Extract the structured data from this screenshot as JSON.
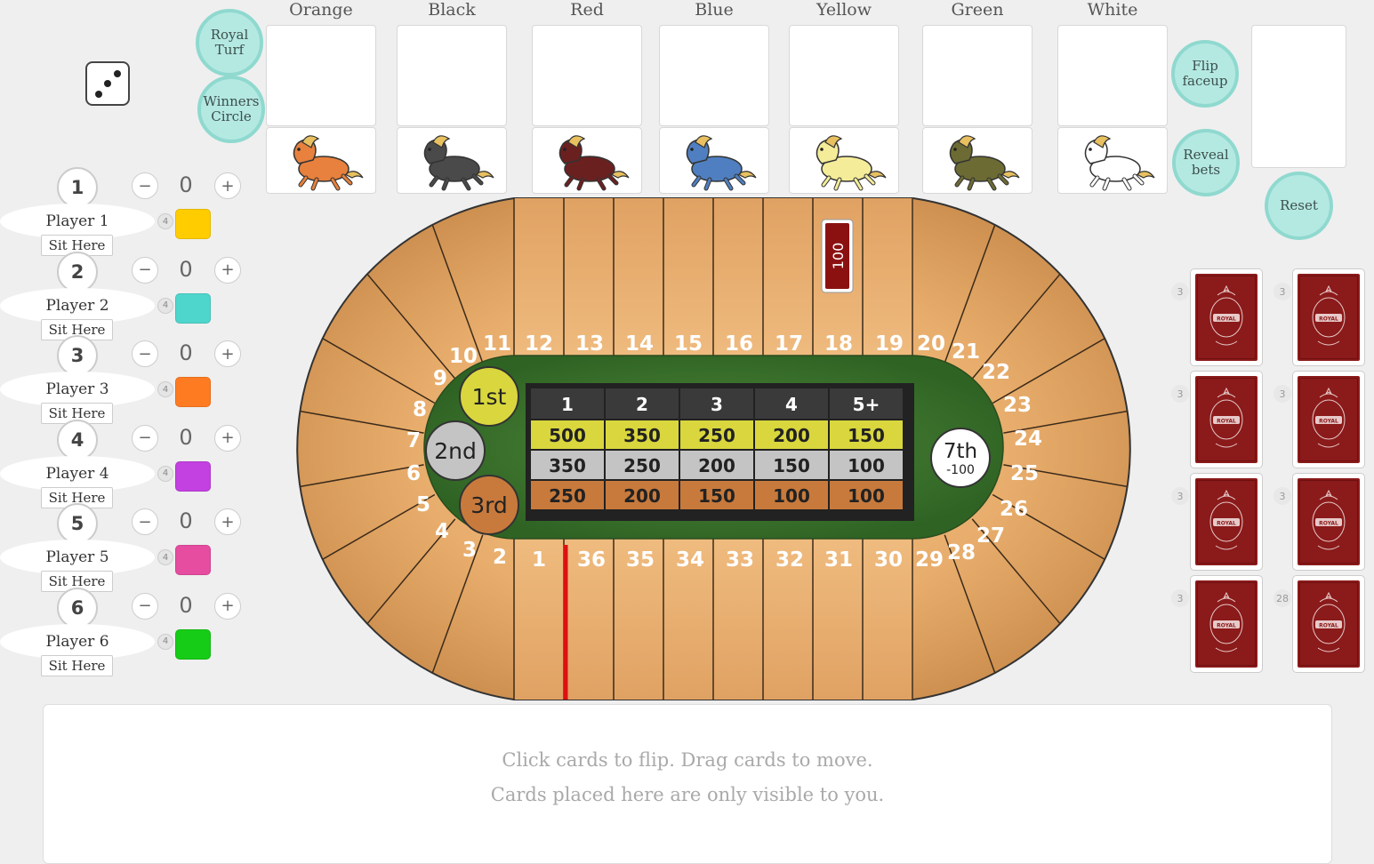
{
  "buttons": {
    "royal_turf": "Royal Turf",
    "winners_circle": "Winners Circle",
    "flip_faceup": "Flip faceup",
    "reveal_bets": "Reveal bets",
    "reset": "Reset"
  },
  "die": {
    "face": 3
  },
  "horses": [
    {
      "name": "Orange",
      "color": "#e7813d"
    },
    {
      "name": "Black",
      "color": "#4a4a4a"
    },
    {
      "name": "Red",
      "color": "#6b2020"
    },
    {
      "name": "Blue",
      "color": "#4f7fc0"
    },
    {
      "name": "Yellow",
      "color": "#f4ec99"
    },
    {
      "name": "Green",
      "color": "#6c6b34"
    },
    {
      "name": "White",
      "color": "#ffffff"
    }
  ],
  "players": [
    {
      "num": "1",
      "score": "0",
      "name": "Player 1",
      "sit": "Sit Here",
      "count": "4",
      "color": "#ffcc00"
    },
    {
      "num": "2",
      "score": "0",
      "name": "Player 2",
      "sit": "Sit Here",
      "count": "4",
      "color": "#4fd6cc"
    },
    {
      "num": "3",
      "score": "0",
      "name": "Player 3",
      "sit": "Sit Here",
      "count": "4",
      "color": "#ff7b22"
    },
    {
      "num": "4",
      "score": "0",
      "name": "Player 4",
      "sit": "Sit Here",
      "count": "4",
      "color": "#c241e0"
    },
    {
      "num": "5",
      "score": "0",
      "name": "Player 5",
      "sit": "Sit Here",
      "count": "4",
      "color": "#e64ca0"
    },
    {
      "num": "6",
      "score": "0",
      "name": "Player 6",
      "sit": "Sit Here",
      "count": "4",
      "color": "#17cc17"
    }
  ],
  "controls": {
    "minus": "−",
    "plus": "+"
  },
  "track": {
    "spaces": [
      "1",
      "2",
      "3",
      "4",
      "5",
      "6",
      "7",
      "8",
      "9",
      "10",
      "11",
      "12",
      "13",
      "14",
      "15",
      "16",
      "17",
      "18",
      "19",
      "20",
      "21",
      "22",
      "23",
      "24",
      "25",
      "26",
      "27",
      "28",
      "29",
      "30",
      "31",
      "32",
      "33",
      "34",
      "35",
      "36"
    ],
    "marker": "100",
    "places": {
      "first": "1st",
      "second": "2nd",
      "third": "3rd",
      "seventh": "7th",
      "seventh_value": "-100"
    }
  },
  "payout_table": {
    "headers": [
      "1",
      "2",
      "3",
      "4",
      "5+"
    ],
    "rows": [
      [
        "500",
        "350",
        "250",
        "200",
        "150"
      ],
      [
        "350",
        "250",
        "200",
        "150",
        "100"
      ],
      [
        "250",
        "200",
        "150",
        "100",
        "100"
      ]
    ]
  },
  "decks": [
    {
      "count": "3"
    },
    {
      "count": "3"
    },
    {
      "count": "3"
    },
    {
      "count": "3"
    },
    {
      "count": "3"
    },
    {
      "count": "3"
    },
    {
      "count": "3"
    },
    {
      "count": "28"
    }
  ],
  "deck_logo": "ROYAL",
  "hand": {
    "line1": "Click cards to flip.   Drag cards to move.",
    "line2": "Cards placed here are only visible to you."
  }
}
